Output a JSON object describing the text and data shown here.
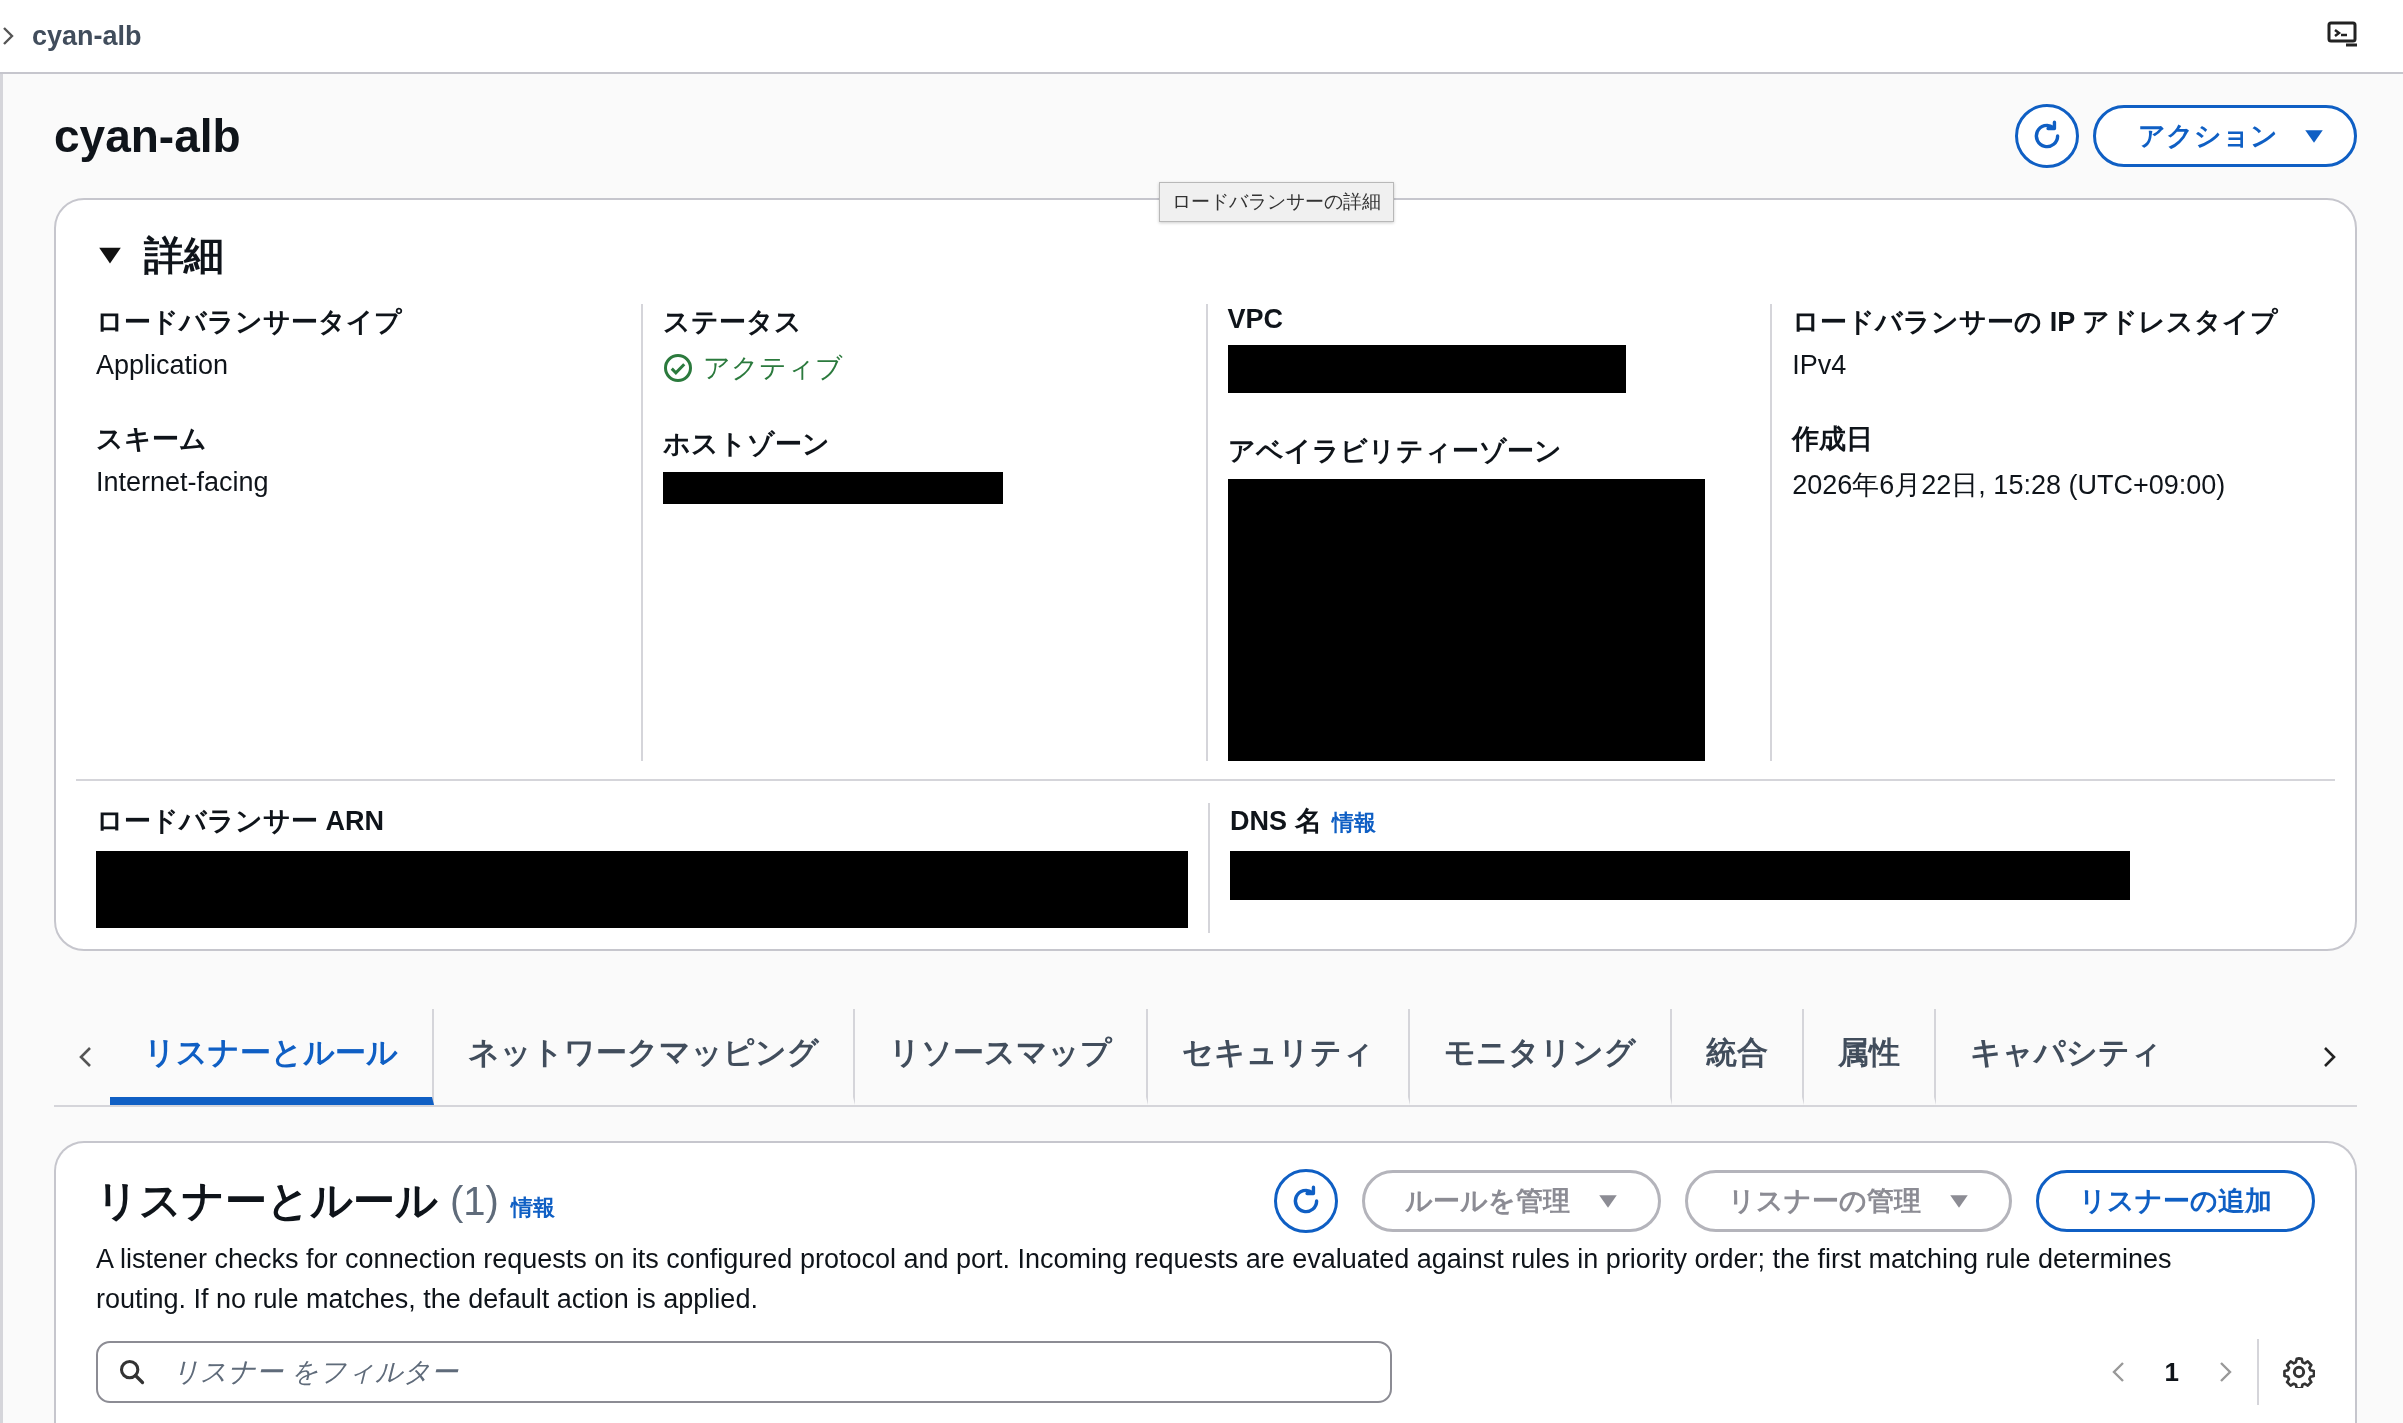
{
  "breadcrumb": {
    "label": "cyan-alb"
  },
  "title": "cyan-alb",
  "header_actions": {
    "action_label": "アクション"
  },
  "tooltip": "ロードバランサーの詳細",
  "details": {
    "heading": "詳細",
    "expanded": true,
    "columns": [
      [
        {
          "label": "ロードバランサータイプ",
          "kind": "text",
          "value": "Application"
        },
        {
          "label": "スキーム",
          "kind": "text",
          "value": "Internet-facing"
        }
      ],
      [
        {
          "label": "ステータス",
          "kind": "status",
          "value": "アクティブ"
        },
        {
          "label": "ホストゾーン",
          "kind": "redacted"
        }
      ],
      [
        {
          "label": "VPC",
          "kind": "redacted"
        },
        {
          "label": "アベイラビリティーゾーン",
          "kind": "redacted"
        }
      ],
      [
        {
          "label": "ロードバランサーの IP アドレスタイプ",
          "kind": "text",
          "value": "IPv4"
        },
        {
          "label": "作成日",
          "kind": "text",
          "value": "2026年6月22日, 15:28 (UTC+09:00)"
        }
      ]
    ],
    "bottom": [
      {
        "label": "ロードバランサー ARN",
        "kind": "redacted"
      },
      {
        "label": "DNS 名",
        "info": "情報",
        "kind": "redacted"
      }
    ]
  },
  "tabs": [
    {
      "label": "リスナーとルール",
      "selected": true
    },
    {
      "label": "ネットワークマッピング",
      "selected": false
    },
    {
      "label": "リソースマップ",
      "selected": false
    },
    {
      "label": "セキュリティ",
      "selected": false
    },
    {
      "label": "モニタリング",
      "selected": false
    },
    {
      "label": "統合",
      "selected": false
    },
    {
      "label": "属性",
      "selected": false
    },
    {
      "label": "キャパシティ",
      "selected": false
    }
  ],
  "listeners": {
    "title": "リスナーとルール",
    "count": "(1)",
    "info": "情報",
    "buttons": [
      {
        "label": "ルールを管理",
        "kind": "dropdown",
        "disabled": true
      },
      {
        "label": "リスナーの管理",
        "kind": "dropdown",
        "disabled": true
      },
      {
        "label": "リスナーの追加",
        "kind": "plain",
        "disabled": false
      }
    ],
    "description": "A listener checks for connection requests on its configured protocol and port. Incoming requests are evaluated against rules in priority order; the first matching rule determines routing. If no rule matches, the default action is applied.",
    "filter": {
      "placeholder": "リスナー をフィルター"
    },
    "pagination": {
      "page": "1"
    }
  }
}
